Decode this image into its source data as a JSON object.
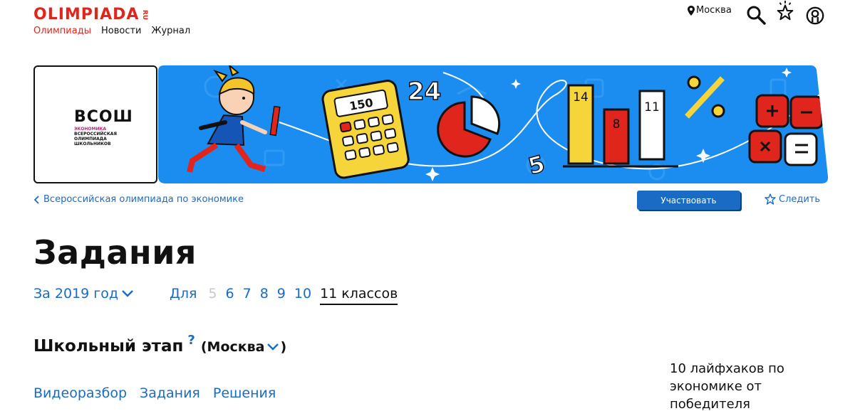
{
  "header": {
    "logo_text": "OLIMPIADA",
    "logo_ru": "RU",
    "nav": [
      "Олимпиады",
      "Новости",
      "Журнал"
    ],
    "city": "Москва",
    "icons": [
      "map-pin-icon",
      "search-icon",
      "star-burst-icon",
      "user-icon"
    ]
  },
  "banner": {
    "logo_main": "ВСОШ",
    "logo_sub_1": "экономика",
    "logo_sub_2": "всероссийская",
    "logo_sub_3": "олимпиада",
    "logo_sub_4": "школьников",
    "numbers": {
      "calc": "150",
      "big": "24",
      "five": "5",
      "bar1": "14",
      "bar2": "8",
      "bar3": "11"
    },
    "colors": {
      "blue": "#1b8cf0",
      "yellow": "#f5d53a",
      "red": "#e0261c"
    }
  },
  "breadcrumb": {
    "text": "Всероссийская олимпиада по экономике"
  },
  "actions": {
    "participate": "Участвовать",
    "follow": "Следить"
  },
  "title": "Задания",
  "year": "За 2019 год",
  "grades": {
    "label": "Для",
    "items": [
      "5",
      "6",
      "7",
      "8",
      "9",
      "10"
    ],
    "current": "11 классов"
  },
  "stage": {
    "title": "Школьный этап",
    "help": "?",
    "region": "(Москва",
    "region_close": ")"
  },
  "links": [
    "Видеоразбор",
    "Задания",
    "Решения"
  ],
  "aside": "10 лайфхаков по экономике от победителя",
  "colors": {
    "accent": "#1a6bc4",
    "brand": "#e0261c"
  }
}
